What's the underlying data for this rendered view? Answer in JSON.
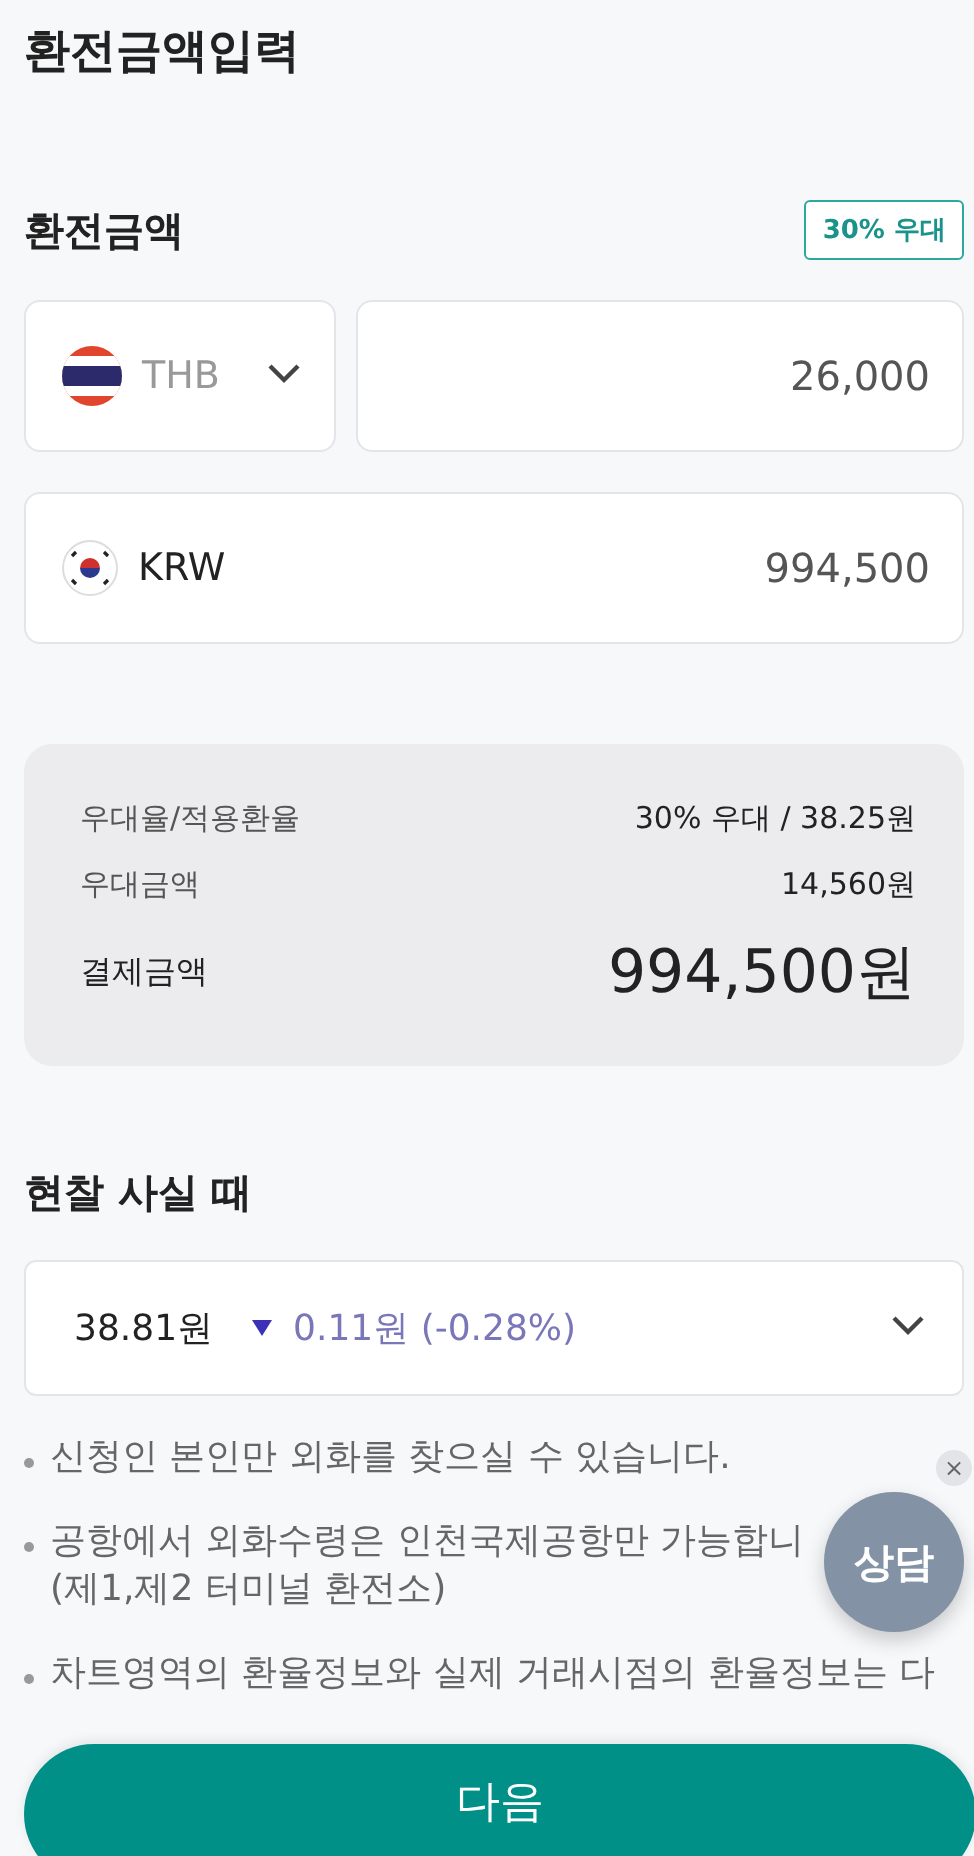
{
  "page_title": "환전금액입력",
  "exchange": {
    "title": "환전금액",
    "badge": "30% 우대",
    "from": {
      "currency": "THB",
      "amount": "26,000"
    },
    "to": {
      "currency": "KRW",
      "amount": "994,500"
    }
  },
  "summary": [
    {
      "kind": "normal",
      "label": "우대율/적용환율",
      "value": "30% 우대 / 38.25원"
    },
    {
      "kind": "normal",
      "label": "우대금액",
      "value": "14,560원"
    },
    {
      "kind": "total",
      "label": "결제금액",
      "value": "994,500원"
    }
  ],
  "cash_rate": {
    "title": "현찰 사실 때",
    "rate": "38.81원",
    "falling": true,
    "change": "0.11원 (-0.28%)"
  },
  "notices": [
    {
      "lines": [
        "신청인 본인만 외화를 찾으실 수 있습니다."
      ]
    },
    {
      "lines": [
        "공항에서 외화수령은 인천국제공항만 가능합니",
        "(제1,제2 터미널 환전소)"
      ]
    },
    {
      "lines": [
        "차트영역의 환율정보와 실제 거래시점의 환율정보는 다"
      ]
    }
  ],
  "chat": {
    "label": "상담",
    "close": "×"
  },
  "next_button": "다음"
}
